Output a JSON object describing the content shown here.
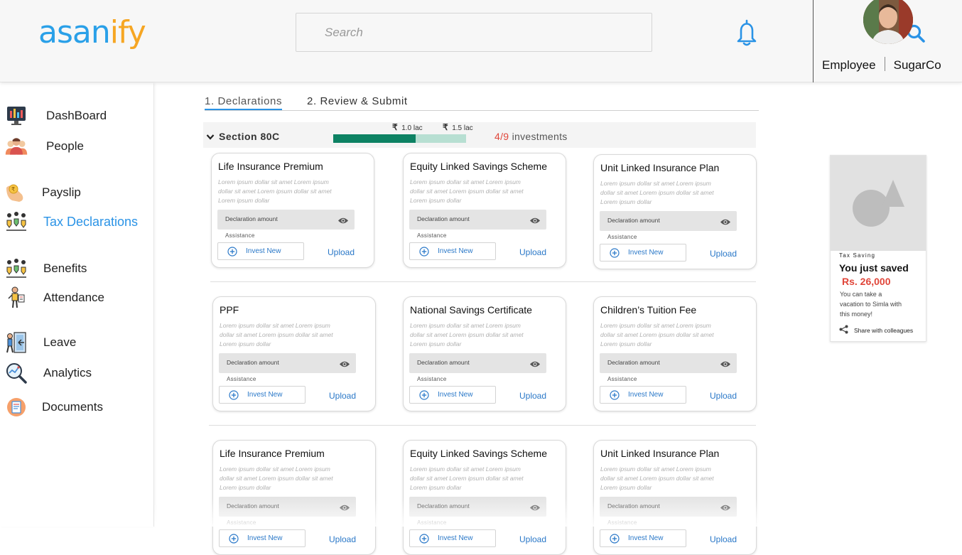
{
  "brand": {
    "part1": "asan",
    "part2": "ify"
  },
  "search": {
    "placeholder": "Search"
  },
  "profile": {
    "role": "Employee",
    "company": "SugarCo"
  },
  "sidebar": {
    "items": [
      {
        "label": "DashBoard",
        "icon": "dashboard-icon"
      },
      {
        "label": "People",
        "icon": "people-icon"
      },
      {
        "label": "Payslip",
        "icon": "payslip-icon"
      },
      {
        "label": "Tax Declarations",
        "icon": "tax-icon",
        "active": true
      },
      {
        "label": "Benefits",
        "icon": "benefits-icon"
      },
      {
        "label": "Attendance",
        "icon": "attendance-icon"
      },
      {
        "label": "Leave",
        "icon": "leave-icon"
      },
      {
        "label": "Analytics",
        "icon": "analytics-icon"
      },
      {
        "label": "Documents",
        "icon": "documents-icon"
      }
    ]
  },
  "tabs": [
    {
      "label": "1. Declarations",
      "active": true
    },
    {
      "label": "2. Review & Submit"
    }
  ],
  "section": {
    "title": "Section 80C",
    "marker1": "1.0 lac",
    "marker2": "1.5 lac",
    "currency": "₹",
    "progress_fraction": 0.62,
    "count": "4/9",
    "count_suffix": "investments"
  },
  "card_labels": {
    "declaration": "Declaration amount",
    "assistance": "Assistance",
    "invest": "Invest New",
    "upload": "Upload"
  },
  "cards": [
    {
      "title": "Life Insurance Premium",
      "desc": "Lorem ipsum dollar sit amet Lorem ipsum dollar sit amet Lorem ipsum dollar sit amet Lorem ipsum dollar"
    },
    {
      "title": "Equity Linked Savings Scheme",
      "desc": "Lorem ipsum dollar sit amet Lorem ipsum dollar sit amet Lorem ipsum dollar sit amet Lorem ipsum dollar"
    },
    {
      "title": "Unit Linked Insurance Plan",
      "desc": "Lorem ipsum dollar sit amet Lorem ipsum dollar sit amet Lorem ipsum dollar sit amet Lorem ipsum dollar"
    },
    {
      "title": "PPF",
      "desc": "Lorem ipsum dollar sit amet Lorem ipsum dollar sit amet Lorem ipsum dollar sit amet Lorem ipsum dollar"
    },
    {
      "title": "National Savings Certificate",
      "desc": "Lorem ipsum dollar sit amet Lorem ipsum dollar sit amet Lorem ipsum dollar sit amet Lorem ipsum dollar"
    },
    {
      "title": "Children’s Tuition Fee",
      "desc": "Lorem ipsum dollar sit amet Lorem ipsum dollar sit amet Lorem ipsum dollar sit amet Lorem ipsum dollar"
    },
    {
      "title": "Life Insurance Premium",
      "desc": "Lorem ipsum dollar sit amet Lorem ipsum dollar sit amet Lorem ipsum dollar sit amet Lorem ipsum dollar"
    },
    {
      "title": "Equity Linked Savings Scheme",
      "desc": "Lorem ipsum dollar sit amet Lorem ipsum dollar sit amet Lorem ipsum dollar sit amet Lorem ipsum dollar"
    },
    {
      "title": "Unit Linked Insurance Plan",
      "desc": "Lorem ipsum dollar sit amet Lorem ipsum dollar sit amet Lorem ipsum dollar sit amet Lorem ipsum dollar"
    }
  ],
  "promo": {
    "kicker": "Tax Saving",
    "headline": "You just saved",
    "amount": "Rs. 26,000",
    "body": "You can take a vacation to Simla with this money!",
    "share": "Share with colleagues"
  },
  "colors": {
    "brand_blue": "#2aa0e8",
    "brand_orange": "#f6a623",
    "accent": "#2a93e6",
    "progress_dark": "#0d8263",
    "progress_light": "#b7dfd2",
    "alert_red": "#e0463a"
  }
}
